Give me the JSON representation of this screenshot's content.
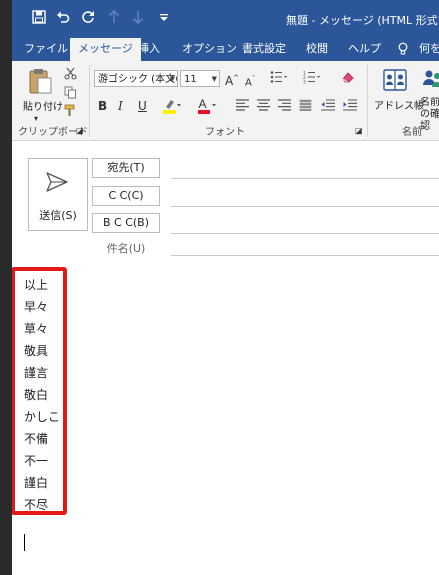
{
  "window": {
    "title": "無題 - メッセージ (HTML 形式)"
  },
  "quick_access": [
    "save-icon",
    "undo-icon",
    "redo-icon",
    "up-arrow-icon",
    "down-arrow-icon",
    "customize-icon"
  ],
  "tabs": [
    {
      "label": "ファイル",
      "active": false
    },
    {
      "label": "メッセージ",
      "active": true
    },
    {
      "label": "挿入",
      "active": false
    },
    {
      "label": "オプション",
      "active": false
    },
    {
      "label": "書式設定",
      "active": false
    },
    {
      "label": "校閲",
      "active": false
    },
    {
      "label": "ヘルプ",
      "active": false
    },
    {
      "label": "何を",
      "active": false
    }
  ],
  "ribbon": {
    "paste_label": "貼り付け",
    "clipboard_label": "クリップボード",
    "font_name": "游ゴシック (本文の",
    "font_size": "11",
    "font_label": "フォント",
    "address_book_label": "アドレス帳",
    "check_names_label": "名前の確認",
    "names_label": "名前"
  },
  "compose": {
    "send_label": "送信(S)",
    "to_label": "宛先(T)",
    "cc_label": "C C(C)",
    "bcc_label": "B C C(B)",
    "subject_label": "件名(U)"
  },
  "body": {
    "phrases": [
      "以上",
      "早々",
      "草々",
      "敬具",
      "謹言",
      "敬白",
      "かしこ",
      "不備",
      "不一",
      "謹白",
      "不尽"
    ]
  },
  "colors": {
    "accent": "#2b579a",
    "highlight": "#e11919",
    "highlight_yellow": "#ffef00",
    "font_red": "#e81123"
  }
}
